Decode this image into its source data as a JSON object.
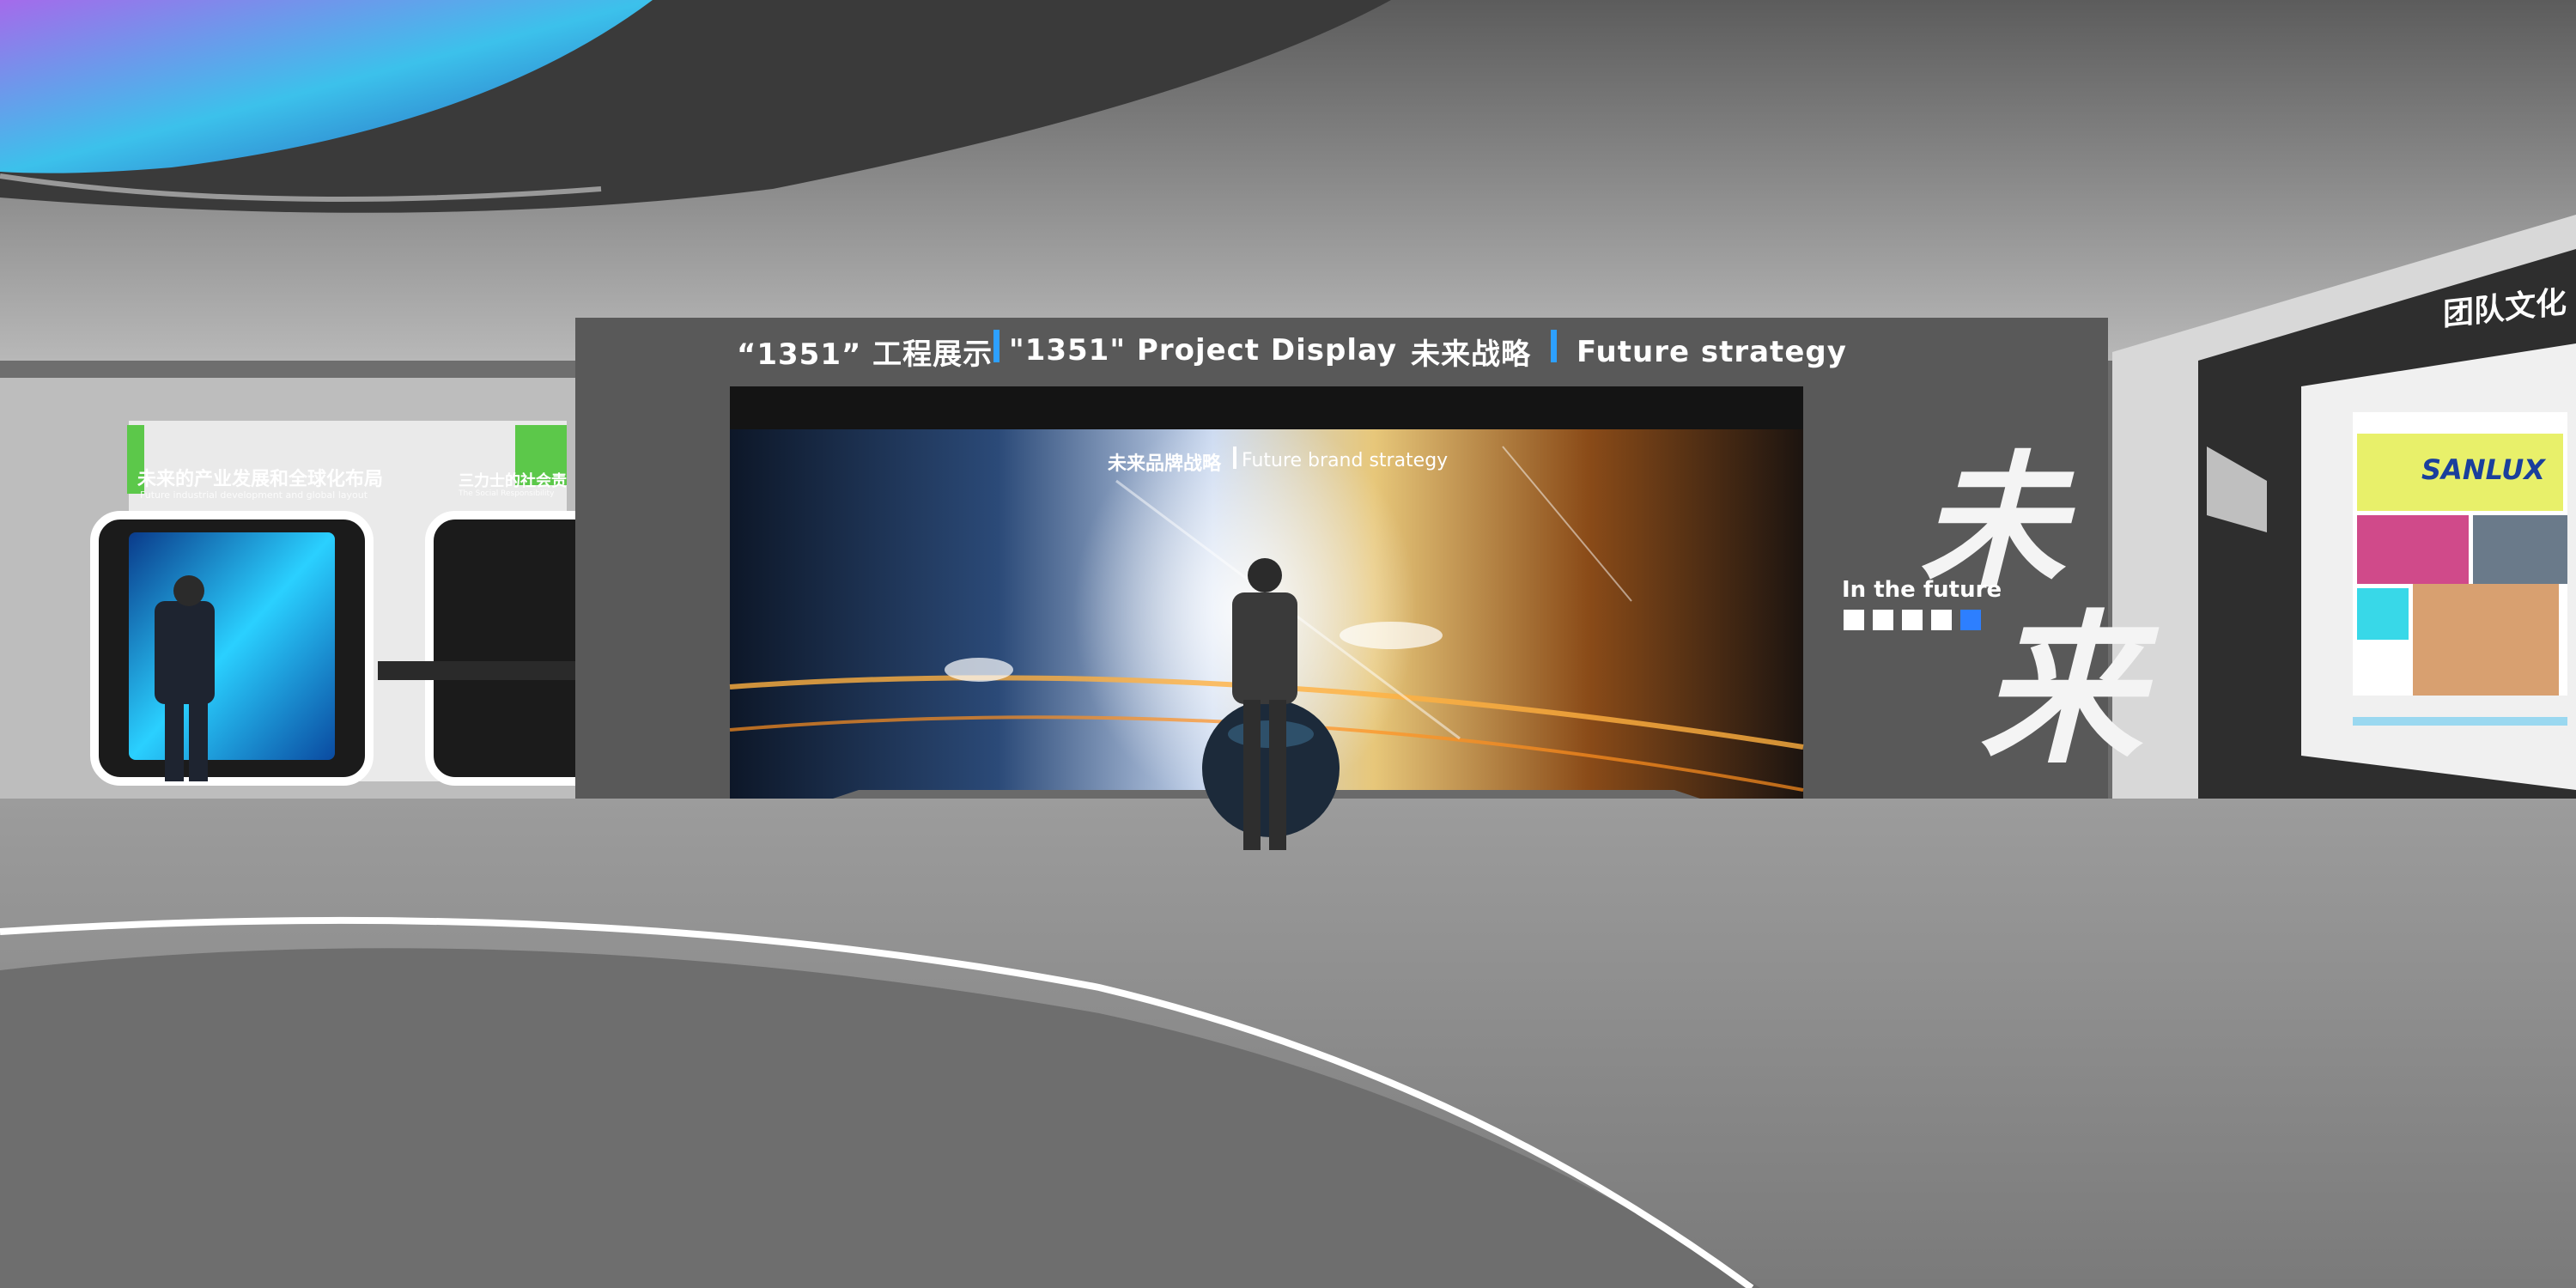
{
  "signage": {
    "project_cn": "“1351” 工程展示",
    "project_en": "\"1351\" Project Display",
    "strategy_cn": "未来战略",
    "strategy_en": "Future strategy",
    "screen_cn": "未来品牌战略",
    "screen_en": "Future brand strategy",
    "future_en": "In the future",
    "future_cn_1": "未",
    "future_cn_2": "来",
    "left_panel_cn": "未来的产业发展和全球化布局",
    "left_panel_en": "Future industrial development and global layout",
    "left_panel2_cn": "三力士的社会责",
    "left_panel2_en": "The Social Responsibility",
    "right_wall_cn": "团队文化",
    "brand_logo": "SANLUX"
  },
  "colors": {
    "accent_blue": "#2da0ff",
    "wall": "#5a5a5a",
    "floor": "#9a9a9a"
  }
}
